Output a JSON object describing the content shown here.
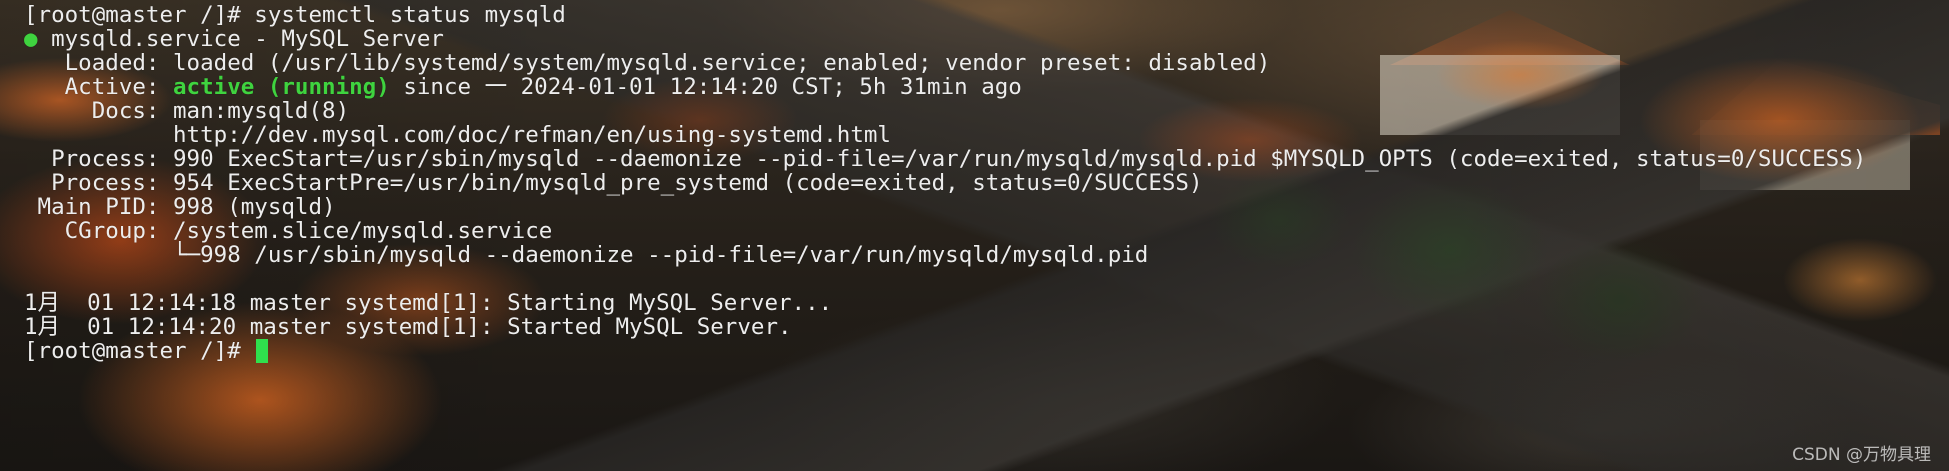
{
  "terminal": {
    "prompt": "[root@master /]#",
    "command": "systemctl status mysqld",
    "service_line": "mysqld.service - MySQL Server",
    "loaded_label": "Loaded:",
    "loaded_value": "loaded (/usr/lib/systemd/system/mysqld.service; enabled; vendor preset: disabled)",
    "active_label": "Active:",
    "active_state": "active (running)",
    "active_rest": "since 一 2024-01-01 12:14:20 CST; 5h 31min ago",
    "docs_label": "Docs:",
    "docs_1": "man:mysqld(8)",
    "docs_2": "http://dev.mysql.com/doc/refman/en/using-systemd.html",
    "process_label": "Process:",
    "process_1": "990 ExecStart=/usr/sbin/mysqld --daemonize --pid-file=/var/run/mysqld/mysqld.pid $MYSQLD_OPTS (code=exited, status=0/SUCCESS)",
    "process_2": "954 ExecStartPre=/usr/bin/mysqld_pre_systemd (code=exited, status=0/SUCCESS)",
    "mainpid_label": "Main PID:",
    "mainpid_value": "998 (mysqld)",
    "cgroup_label": "CGroup:",
    "cgroup_value": "/system.slice/mysqld.service",
    "cgroup_child": "└─998 /usr/sbin/mysqld --daemonize --pid-file=/var/run/mysqld/mysqld.pid",
    "log_1": "1月  01 12:14:18 master systemd[1]: Starting MySQL Server...",
    "log_2": "1月  01 12:14:20 master systemd[1]: Started MySQL Server.",
    "final_prompt": "[root@master /]#",
    "status_dot": "●"
  },
  "watermark": "CSDN @万物具理",
  "colors": {
    "text": "#ededed",
    "active_green": "#3fd33f",
    "cursor": "#2fe04d"
  }
}
